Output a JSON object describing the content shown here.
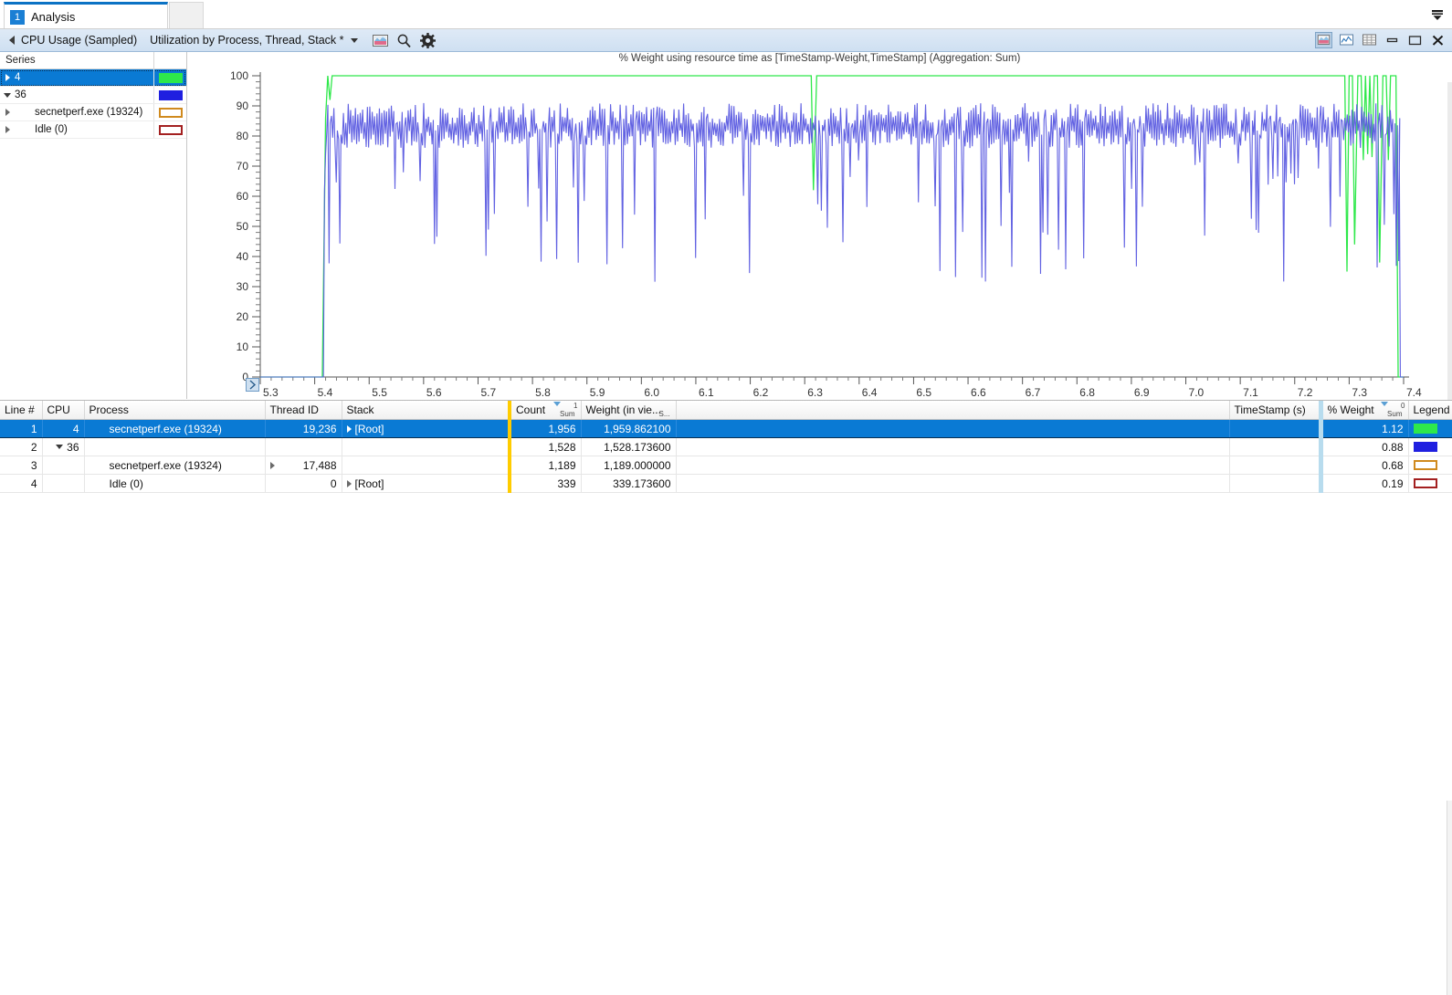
{
  "window": {
    "tab": {
      "number": "1",
      "label": "Analysis"
    },
    "topright_icon": "chevron-down-icon"
  },
  "graph_window": {
    "name": "CPU Usage (Sampled)",
    "preset": "Utilization by Process, Thread, Stack *",
    "toolbar_icons": [
      "chart-thumbnail-icon",
      "search-icon",
      "gear-icon"
    ],
    "window_controls": [
      "graph-view-icon",
      "graph-and-table-icon",
      "table-view-icon",
      "minimize-icon",
      "maximize-icon",
      "close-icon"
    ]
  },
  "series_panel": {
    "header": "Series",
    "items": [
      {
        "label": "4",
        "color": "#2ee84a",
        "filled": true,
        "expander": "right",
        "indent": 0,
        "selected": true
      },
      {
        "label": "36",
        "color": "#1f1fe0",
        "filled": true,
        "expander": "down",
        "indent": 0,
        "selected": false
      },
      {
        "label": "secnetperf.exe (19324)",
        "color": "#d08a1e",
        "filled": false,
        "expander": "right",
        "indent": 1,
        "selected": false
      },
      {
        "label": "Idle (0)",
        "color": "#a32020",
        "filled": false,
        "expander": "right",
        "indent": 1,
        "selected": false
      }
    ]
  },
  "chart_data": {
    "type": "line",
    "title": "% Weight using resource time as [TimeStamp-Weight,TimeStamp] (Aggregation: Sum)",
    "xlabel": "",
    "ylabel": "",
    "xlim": [
      5.3,
      7.4
    ],
    "ylim": [
      0,
      100
    ],
    "xticks": [
      "5.3",
      "5.4",
      "5.5",
      "5.6",
      "5.7",
      "5.8",
      "5.9",
      "6.0",
      "6.1",
      "6.2",
      "6.3",
      "6.4",
      "6.5",
      "6.6",
      "6.7",
      "6.8",
      "6.9",
      "7.0",
      "7.1",
      "7.2",
      "7.3",
      "7.4"
    ],
    "yticks": [
      "0",
      "10",
      "20",
      "30",
      "40",
      "50",
      "60",
      "70",
      "80",
      "90",
      "100"
    ],
    "minor_ticks_per_major": 5,
    "grid": false,
    "legend_position": "left-panel",
    "series": [
      {
        "name": "4",
        "color": "#2ee84a",
        "points": [
          [
            5.3,
            0
          ],
          [
            5.414,
            0
          ],
          [
            5.42,
            86
          ],
          [
            5.424,
            100
          ],
          [
            5.428,
            92
          ],
          [
            5.432,
            100
          ],
          [
            5.436,
            100
          ],
          [
            6.3,
            100
          ],
          [
            6.312,
            100
          ],
          [
            6.316,
            62
          ],
          [
            6.322,
            100
          ],
          [
            6.4,
            100
          ],
          [
            7.285,
            100
          ],
          [
            7.292,
            100
          ],
          [
            7.296,
            35
          ],
          [
            7.3,
            100
          ],
          [
            7.306,
            100
          ],
          [
            7.31,
            44
          ],
          [
            7.316,
            100
          ],
          [
            7.322,
            100
          ],
          [
            7.326,
            72
          ],
          [
            7.33,
            100
          ],
          [
            7.334,
            74
          ],
          [
            7.338,
            100
          ],
          [
            7.342,
            73
          ],
          [
            7.346,
            100
          ],
          [
            7.352,
            100
          ],
          [
            7.356,
            38
          ],
          [
            7.362,
            100
          ],
          [
            7.368,
            100
          ],
          [
            7.372,
            72
          ],
          [
            7.376,
            100
          ],
          [
            7.38,
            100
          ],
          [
            7.386,
            100
          ],
          [
            7.39,
            0
          ],
          [
            7.4,
            0
          ]
        ]
      },
      {
        "name": "36",
        "color": "#5a5ae0",
        "baseline": 82,
        "range": [
          74,
          91
        ],
        "dip_floor_range": [
          30,
          72
        ],
        "description": "High-frequency oscillation around 80-85 with frequent deep downward spikes reaching 30-60"
      }
    ]
  },
  "table": {
    "columns": [
      {
        "key": "line",
        "label": "Line #",
        "align": "right"
      },
      {
        "key": "cpu",
        "label": "CPU",
        "align": "right"
      },
      {
        "key": "process",
        "label": "Process",
        "align": "left"
      },
      {
        "key": "thread",
        "label": "Thread ID",
        "align": "right"
      },
      {
        "key": "stack",
        "label": "Stack",
        "align": "left"
      },
      {
        "key": "count",
        "label": "Count",
        "align": "right",
        "sort": "desc",
        "aggregation": "Sum",
        "order": "1",
        "divider": "gold"
      },
      {
        "key": "weight",
        "label": "Weight (in vie...",
        "align": "right",
        "aggregation": "S..."
      },
      {
        "key": "spacer",
        "label": "",
        "align": "left"
      },
      {
        "key": "ts",
        "label": "TimeStamp (s)",
        "align": "left"
      },
      {
        "key": "pct",
        "label": "% Weight",
        "align": "right",
        "sort": "desc",
        "aggregation": "Sum",
        "order": "0",
        "divider": "blue"
      },
      {
        "key": "legend",
        "label": "Legend",
        "align": "left"
      }
    ],
    "rows": [
      {
        "line": "1",
        "cpu": "4",
        "process": "secnetperf.exe (19324)",
        "process_indent": 1,
        "thread": "19,236",
        "thread_expander": false,
        "stack": "[Root]",
        "stack_expander": true,
        "count": "1,956",
        "weight": "1,959.862100",
        "ts": "",
        "pct": "1.12",
        "legend_color": "#2ee84a",
        "legend_filled": true,
        "selected": true,
        "cpu_expander": "none"
      },
      {
        "line": "2",
        "cpu": "36",
        "process": "",
        "process_indent": 0,
        "thread": "",
        "thread_expander": false,
        "stack": "",
        "stack_expander": false,
        "count": "1,528",
        "weight": "1,528.173600",
        "ts": "",
        "pct": "0.88",
        "legend_color": "#1f1fe0",
        "legend_filled": true,
        "selected": false,
        "cpu_expander": "down"
      },
      {
        "line": "3",
        "cpu": "",
        "process": "secnetperf.exe (19324)",
        "process_indent": 1,
        "thread": "17,488",
        "thread_expander": true,
        "stack": "",
        "stack_expander": false,
        "count": "1,189",
        "weight": "1,189.000000",
        "ts": "",
        "pct": "0.68",
        "legend_color": "#d08a1e",
        "legend_filled": false,
        "selected": false,
        "cpu_expander": "none"
      },
      {
        "line": "4",
        "cpu": "",
        "process": "Idle (0)",
        "process_indent": 1,
        "thread": "0",
        "thread_expander": false,
        "stack": "[Root]",
        "stack_expander": true,
        "count": "339",
        "weight": "339.173600",
        "ts": "",
        "pct": "0.19",
        "legend_color": "#a32020",
        "legend_filled": false,
        "selected": false,
        "cpu_expander": "none"
      }
    ]
  }
}
